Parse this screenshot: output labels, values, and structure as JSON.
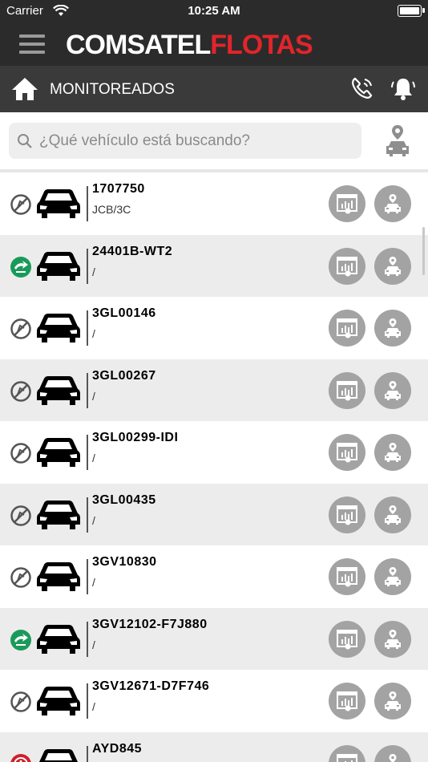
{
  "status_bar": {
    "carrier": "Carrier",
    "time": "10:25 AM"
  },
  "header": {
    "logo_part1": "COMSATEL",
    "logo_part2": "FLOTAS"
  },
  "section": {
    "title": "MONITOREADOS"
  },
  "search": {
    "placeholder": "¿Qué vehículo está buscando?"
  },
  "colors": {
    "bar": "#2b2b2b",
    "section": "#3a3a3a",
    "brand_red": "#e3242b",
    "state_green": "#1a9a5a",
    "state_gray": "#555555",
    "state_red": "#d0202a"
  },
  "vehicles": [
    {
      "plate": "1707750",
      "sub": "JCB/3C",
      "state": "off"
    },
    {
      "plate": "24401B-WT2",
      "sub": "/",
      "state": "moving"
    },
    {
      "plate": "3GL00146",
      "sub": "/",
      "state": "off"
    },
    {
      "plate": "3GL00267",
      "sub": "/",
      "state": "off"
    },
    {
      "plate": "3GL00299-IDI",
      "sub": "/",
      "state": "off"
    },
    {
      "plate": "3GL00435",
      "sub": "/",
      "state": "off"
    },
    {
      "plate": "3GV10830",
      "sub": "/",
      "state": "off"
    },
    {
      "plate": "3GV12102-F7J880",
      "sub": "/",
      "state": "moving"
    },
    {
      "plate": "3GV12671-D7F746",
      "sub": "/",
      "state": "off"
    },
    {
      "plate": "AYD845",
      "sub": "",
      "state": "alert"
    }
  ]
}
